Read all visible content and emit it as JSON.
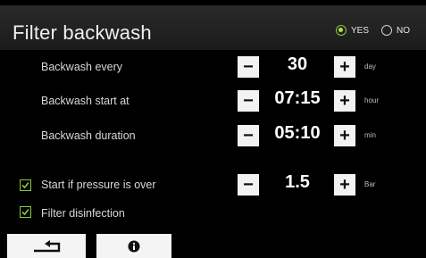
{
  "header": {
    "title": "Filter backwash",
    "options": [
      {
        "label": "YES",
        "selected": true
      },
      {
        "label": "NO",
        "selected": false
      }
    ]
  },
  "rows": [
    {
      "label": "Backwash every",
      "value": "30",
      "unit": "day"
    },
    {
      "label": "Backwash start at",
      "value": "07:15",
      "unit": "hour"
    },
    {
      "label": "Backwash duration",
      "value": "05:10",
      "unit": "min"
    },
    {
      "label": "Start if pressure is over",
      "value": "1.5",
      "unit": "Bar",
      "checked": true
    }
  ],
  "filter_disinfection": {
    "label": "Filter disinfection",
    "checked": true
  },
  "controls": {
    "minus": "−",
    "plus": "+"
  },
  "bottom": {
    "icons": [
      "back-arrow-icon",
      "info-icon"
    ]
  },
  "colors": {
    "accent": "#8dc63f",
    "background": "#000000",
    "button": "#f2f2f2"
  }
}
